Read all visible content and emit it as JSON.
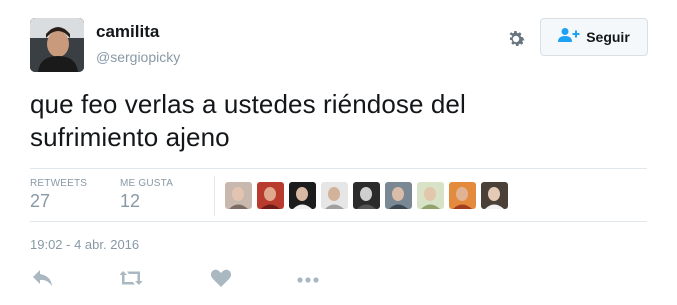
{
  "user": {
    "name": "camilita",
    "handle": "@sergiopicky"
  },
  "follow_button": {
    "label": "Seguir"
  },
  "tweet": {
    "text_line1": "que feo verlas a ustedes riéndose del",
    "text_line2": "sufrimiento ajeno",
    "timestamp": "19:02 - 4 abr. 2016"
  },
  "stats": {
    "retweets_label": "RETWEETS",
    "retweets_count": "27",
    "likes_label": "ME GUSTA",
    "likes_count": "12"
  },
  "liker_avatars": [
    "avatar-1",
    "avatar-2",
    "avatar-3",
    "avatar-4",
    "avatar-5",
    "avatar-6",
    "avatar-7",
    "avatar-8",
    "avatar-9"
  ],
  "icons": {
    "settings": "gear-icon",
    "follow": "person-plus-icon",
    "reply": "reply-icon",
    "retweet": "retweet-icon",
    "like": "heart-icon",
    "more": "more-icon"
  },
  "colors": {
    "text_primary": "#14171a",
    "text_muted": "#8899a6",
    "accent_blue": "#1da1f2",
    "divider": "#e1e8ed"
  }
}
